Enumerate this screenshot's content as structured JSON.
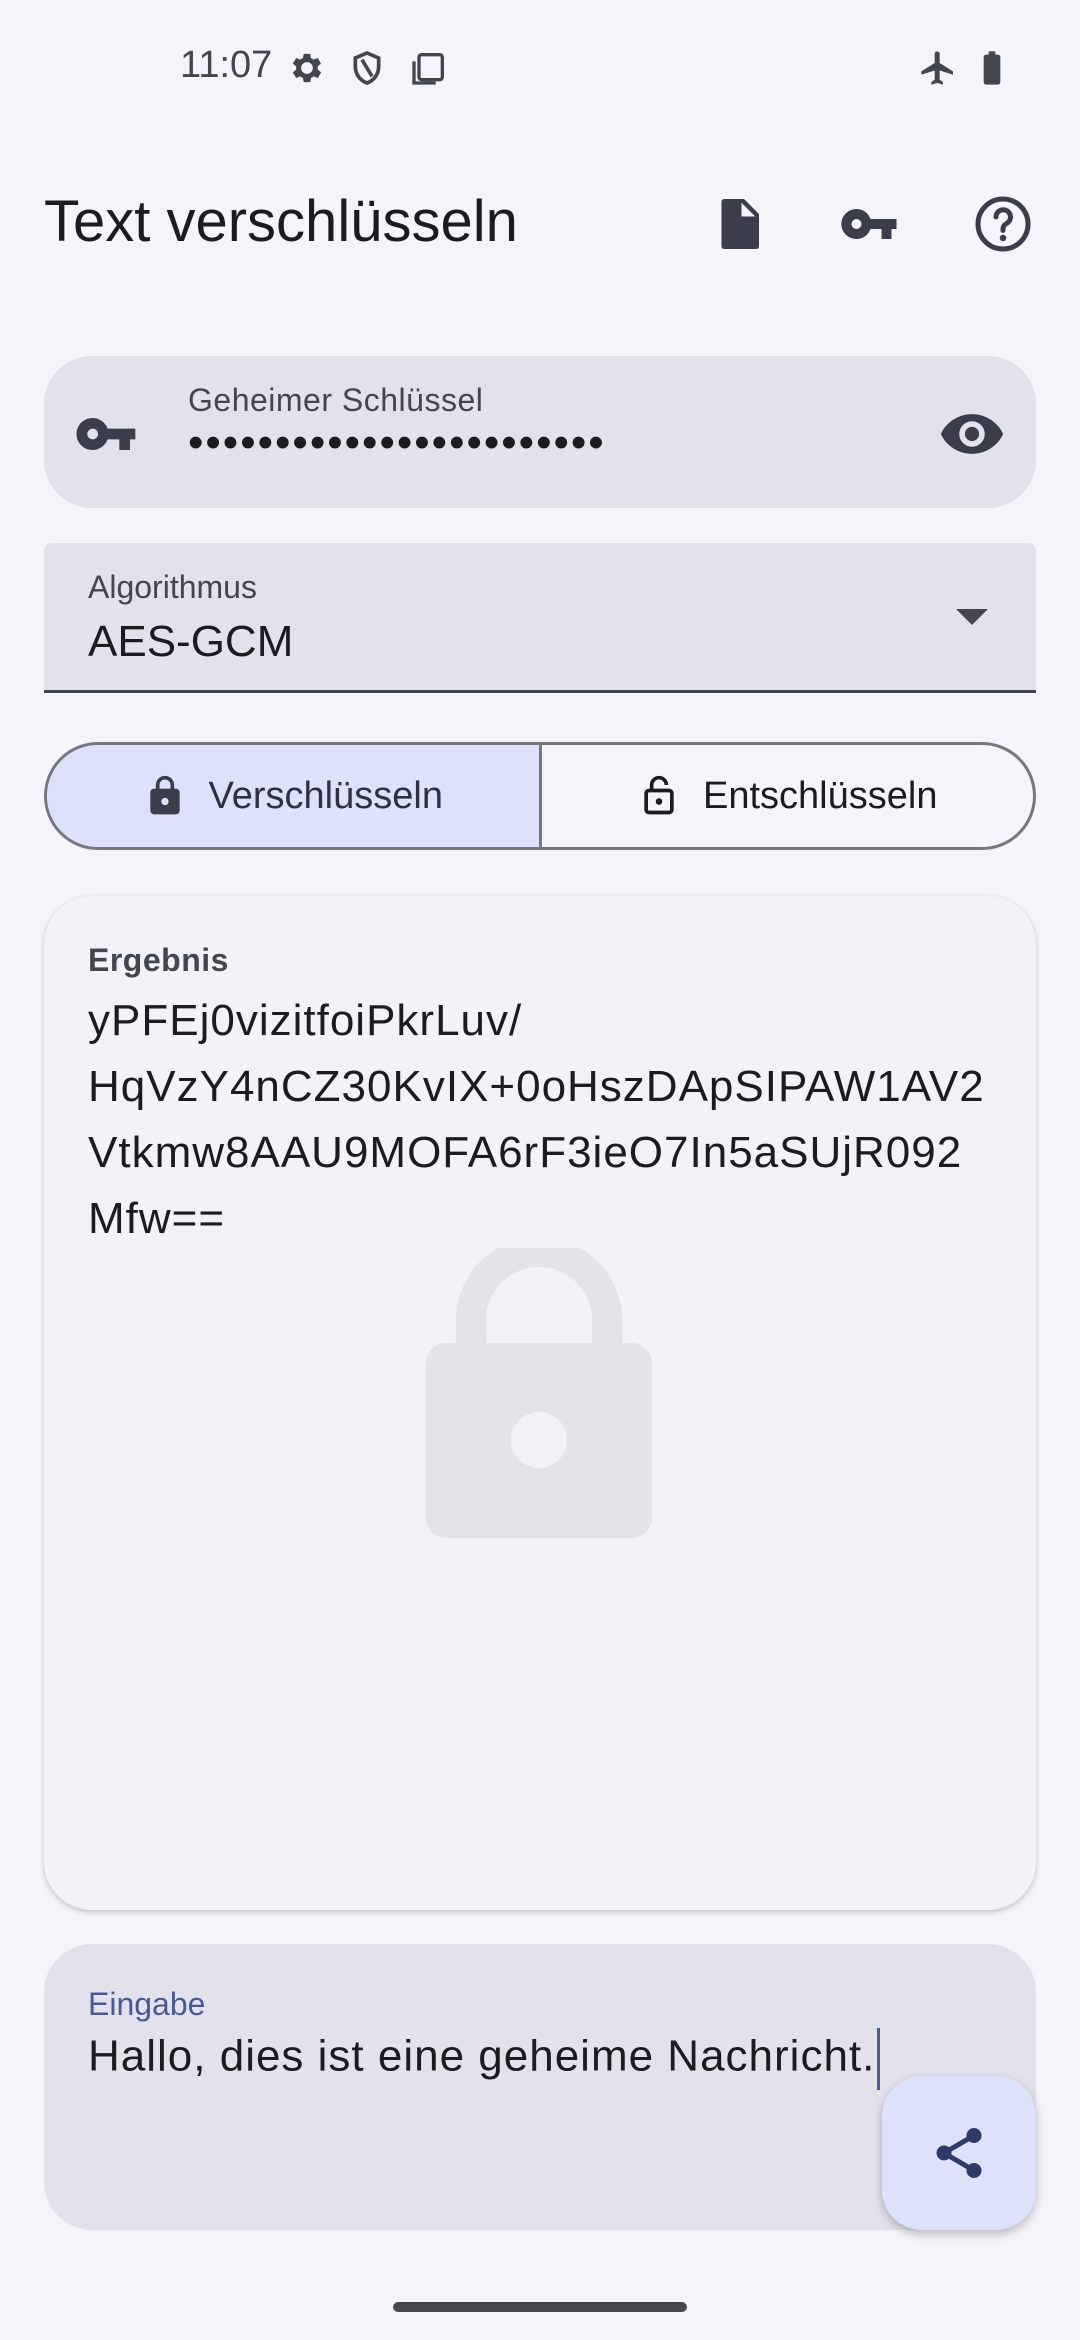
{
  "status_bar": {
    "time": "11:07",
    "left_icons": [
      "gear-icon",
      "shield-icon",
      "screen-icon"
    ],
    "right_icons": [
      "airplane-icon",
      "battery-icon"
    ]
  },
  "app_bar": {
    "title": "Text verschlüsseln",
    "actions": [
      "file-icon",
      "key-icon",
      "help-icon"
    ]
  },
  "key_field": {
    "label": "Geheimer Schlüssel",
    "value": "••••••••••••••••••••••••"
  },
  "algorithm": {
    "label": "Algorithmus",
    "selected": "AES-GCM"
  },
  "mode": {
    "encrypt_label": "Verschlüsseln",
    "decrypt_label": "Entschlüsseln",
    "selected": "Verschlüsseln"
  },
  "result": {
    "label": "Ergebnis",
    "lines": [
      "yPFEj0vizitfoiPkrLuv/",
      "HqVzY4nCZ30KvIX+0oHszDApSIPAW1AV2",
      "Vtkmw8AAU9MOFA6rF3ieO7In5aSUjR092",
      "Mfw=="
    ]
  },
  "input": {
    "label": "Eingabe",
    "value": "Hallo, dies ist eine geheime Nachricht."
  },
  "colors": {
    "background": "#f5f4fb",
    "field": "#e3e2ec",
    "accent": "#4a5a92",
    "selected_segment": "#dde1f9"
  }
}
